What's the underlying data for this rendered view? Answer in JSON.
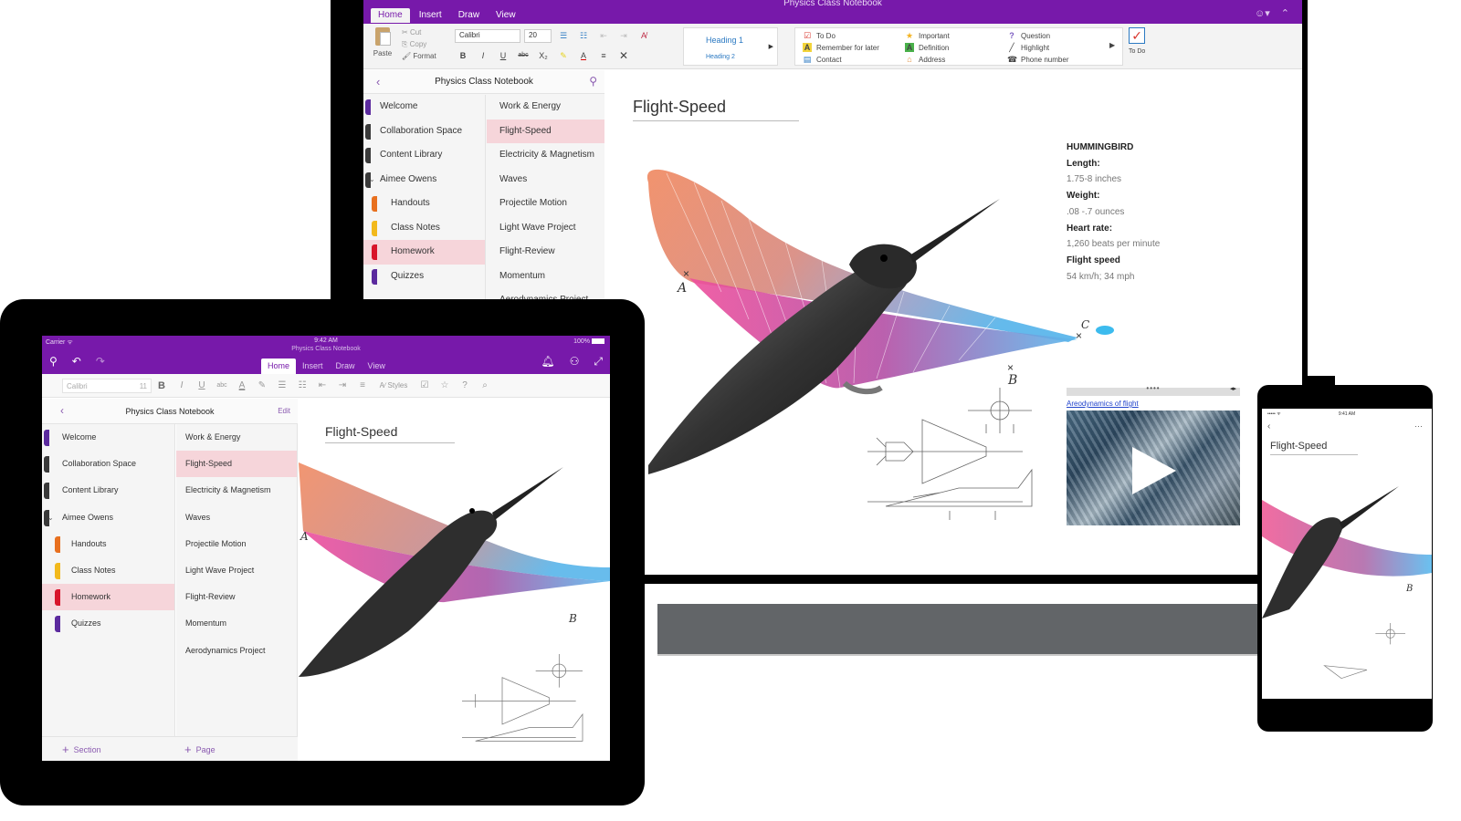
{
  "notebook_title": "Physics Class Notebook",
  "page_title": "Flight-Speed",
  "desktop": {
    "window_title": "Physics Class Notebook",
    "tabs": [
      {
        "label": "Home",
        "active": true
      },
      {
        "label": "Insert",
        "active": false
      },
      {
        "label": "Draw",
        "active": false
      },
      {
        "label": "View",
        "active": false
      }
    ],
    "ribbon": {
      "paste": "Paste",
      "cut": "Cut",
      "copy": "Copy",
      "format": "Format",
      "font": "Calibri",
      "font_size": "20",
      "bold": "B",
      "italic": "I",
      "underline": "U",
      "strike": "abc",
      "subscript": "X₂",
      "styles": {
        "heading1": "Heading 1",
        "heading2": "Heading 2"
      },
      "tags": [
        {
          "label": "To Do",
          "icon": "checkbox-icon",
          "glyph": "☑",
          "color": "#d9342b"
        },
        {
          "label": "Remember for later",
          "icon": "highlight-a-icon",
          "glyph": "A",
          "color": "#f2d43b"
        },
        {
          "label": "Contact",
          "icon": "contact-icon",
          "glyph": "▤",
          "color": "#2b79c2"
        },
        {
          "label": "Important",
          "icon": "star-icon",
          "glyph": "★",
          "color": "#f3b321"
        },
        {
          "label": "Definition",
          "icon": "definition-a-icon",
          "glyph": "A",
          "color": "#49b14a"
        },
        {
          "label": "Address",
          "icon": "house-icon",
          "glyph": "⌂",
          "color": "#e08e3a"
        },
        {
          "label": "Question",
          "icon": "question-icon",
          "glyph": "?",
          "color": "#7a5ac0"
        },
        {
          "label": "Highlight",
          "icon": "pen-icon",
          "glyph": "╱",
          "color": "#444444"
        },
        {
          "label": "Phone number",
          "icon": "phone-icon",
          "glyph": "☎",
          "color": "#333333"
        }
      ],
      "todo_button": "To Do"
    },
    "sections": [
      {
        "label": "Welcome",
        "color": "#5b2a9e",
        "indent": false,
        "selected": false
      },
      {
        "label": "Collaboration Space",
        "color": "#3a3a3a",
        "indent": false,
        "selected": false
      },
      {
        "label": "Content Library",
        "color": "#3a3a3a",
        "indent": false,
        "selected": false
      },
      {
        "label": "Aimee Owens",
        "color": "#3a3a3a",
        "indent": false,
        "selected": false,
        "group": true
      },
      {
        "label": "Handouts",
        "color": "#e8701f",
        "indent": true,
        "selected": false
      },
      {
        "label": "Class Notes",
        "color": "#f2b91c",
        "indent": true,
        "selected": false
      },
      {
        "label": "Homework",
        "color": "#d8142a",
        "indent": true,
        "selected": true
      },
      {
        "label": "Quizzes",
        "color": "#5b2a9e",
        "indent": true,
        "selected": false
      }
    ],
    "pages": [
      {
        "label": "Work & Energy",
        "selected": false
      },
      {
        "label": "Flight-Speed",
        "selected": true
      },
      {
        "label": "Electricity & Magnetism",
        "selected": false
      },
      {
        "label": "Waves",
        "selected": false
      },
      {
        "label": "Projectile Motion",
        "selected": false
      },
      {
        "label": "Light Wave Project",
        "selected": false
      },
      {
        "label": "Flight-Review",
        "selected": false
      },
      {
        "label": "Momentum",
        "selected": false
      },
      {
        "label": "Aerodynamics Project",
        "selected": false
      }
    ],
    "bird_info": {
      "heading": "HUMMINGBIRD",
      "length_label": "Length:",
      "length_value": "1.75-8 inches",
      "weight_label": "Weight:",
      "weight_value": ".08 -.7 ounces",
      "heart_label": "Heart rate:",
      "heart_value": "1,260 beats per minute",
      "speed_label": "Flight speed",
      "speed_value": "54 km/h; 34 mph"
    },
    "video": {
      "link_text": "Areodynamics of flight",
      "handle": "••••",
      "controls": "◂▸"
    },
    "points": {
      "a": "A",
      "b": "B",
      "c": "C"
    }
  },
  "tablet": {
    "status": {
      "carrier": "Carrier ᯤ",
      "time": "9:42 AM",
      "battery": "100%"
    },
    "tabs": [
      {
        "label": "Home",
        "active": true
      },
      {
        "label": "Insert",
        "active": false
      },
      {
        "label": "Draw",
        "active": false
      },
      {
        "label": "View",
        "active": false
      }
    ],
    "ribbon": {
      "font": "Calibri",
      "font_size": "11",
      "styles": "Styles"
    },
    "edit": "Edit",
    "add_section": "Section",
    "add_page": "Page"
  },
  "phone": {
    "status": {
      "carrier": "•••••  ᯤ",
      "time": "9:41 AM"
    }
  }
}
